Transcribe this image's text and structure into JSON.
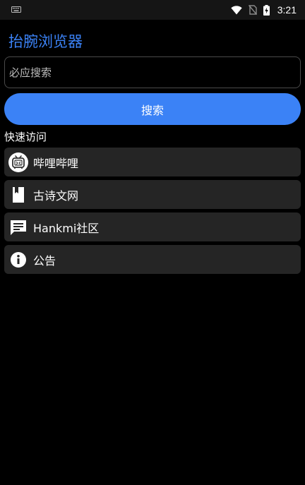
{
  "status_bar": {
    "time": "3:21"
  },
  "app": {
    "title": "抬腕浏览器"
  },
  "search": {
    "placeholder": "必应搜索",
    "value": "",
    "button_label": "搜索"
  },
  "quick_access": {
    "title": "快速访问",
    "items": [
      {
        "label": "哔哩哔哩",
        "icon": "bilibili-tv-icon"
      },
      {
        "label": "古诗文网",
        "icon": "book-icon"
      },
      {
        "label": "Hankmi社区",
        "icon": "chat-message-icon"
      },
      {
        "label": "公告",
        "icon": "info-icon"
      }
    ]
  },
  "colors": {
    "accent": "#3b82f6",
    "background": "#000000",
    "item_background": "#252525",
    "status_bar": "#151515"
  }
}
